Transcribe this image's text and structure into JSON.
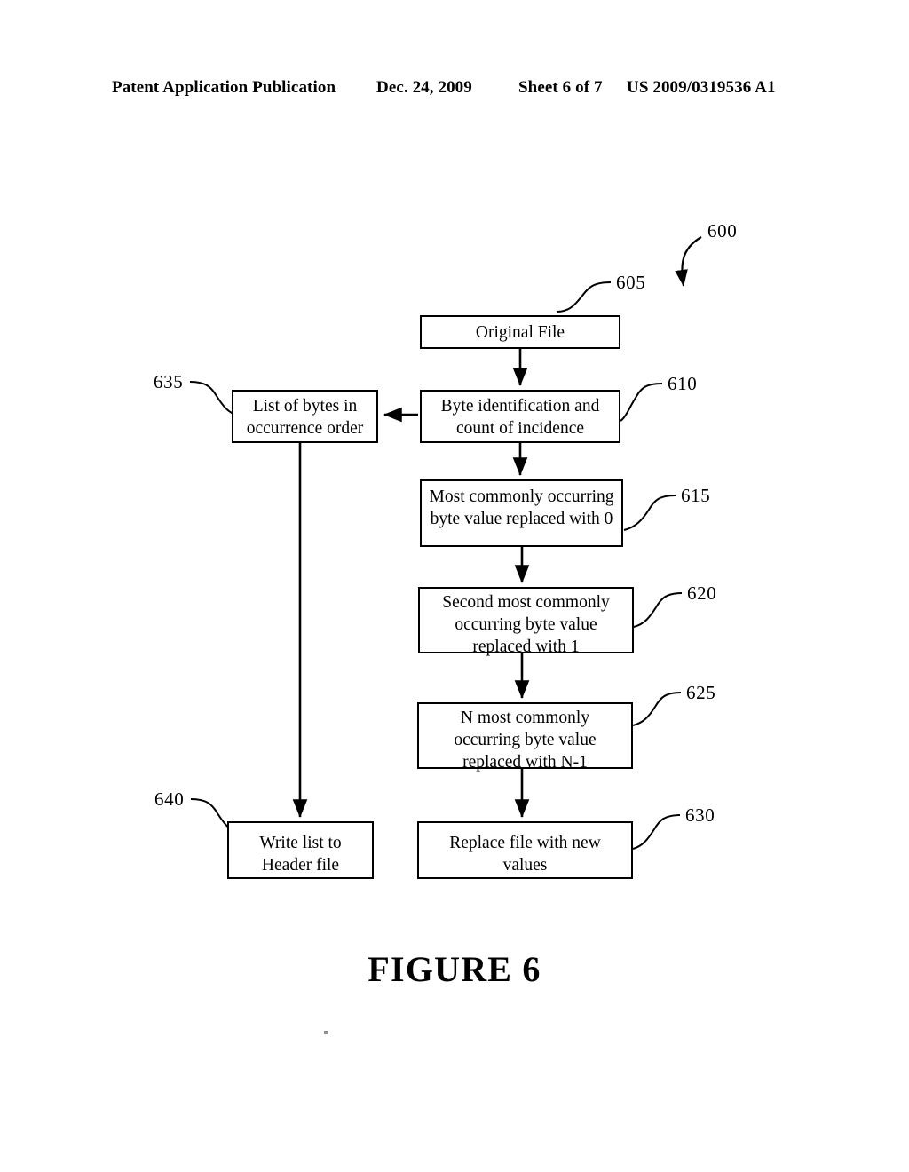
{
  "header": {
    "left": "Patent Application Publication",
    "date": "Dec. 24, 2009",
    "sheet": "Sheet 6 of 7",
    "publication_number": "US 2009/0319536 A1"
  },
  "figure": {
    "caption": "FIGURE 6",
    "diagram_ref": "600"
  },
  "nodes": [
    {
      "id": "605",
      "ref": "605",
      "text": "Original File"
    },
    {
      "id": "610",
      "ref": "610",
      "text": "Byte identification and\ncount of incidence"
    },
    {
      "id": "615",
      "ref": "615",
      "text": "Most commonly occurring\nbyte value replaced with 0"
    },
    {
      "id": "620",
      "ref": "620",
      "text": "Second most commonly\noccurring byte value\nreplaced with 1"
    },
    {
      "id": "625",
      "ref": "625",
      "text": "N most commonly\noccurring byte value\nreplaced with N-1"
    },
    {
      "id": "630",
      "ref": "630",
      "text": "Replace file with new\nvalues"
    },
    {
      "id": "635",
      "ref": "635",
      "text": "List of bytes in\noccurrence order"
    },
    {
      "id": "640",
      "ref": "640",
      "text": "Write list to\nHeader file"
    }
  ],
  "edges": [
    {
      "from": "605",
      "to": "610",
      "direction": "down"
    },
    {
      "from": "610",
      "to": "635",
      "direction": "left"
    },
    {
      "from": "610",
      "to": "615",
      "direction": "down"
    },
    {
      "from": "615",
      "to": "620",
      "direction": "down"
    },
    {
      "from": "620",
      "to": "625",
      "direction": "down"
    },
    {
      "from": "625",
      "to": "630",
      "direction": "down"
    },
    {
      "from": "635",
      "to": "640",
      "direction": "down"
    }
  ],
  "colors": {
    "ink": "#000000",
    "paper": "#ffffff"
  }
}
